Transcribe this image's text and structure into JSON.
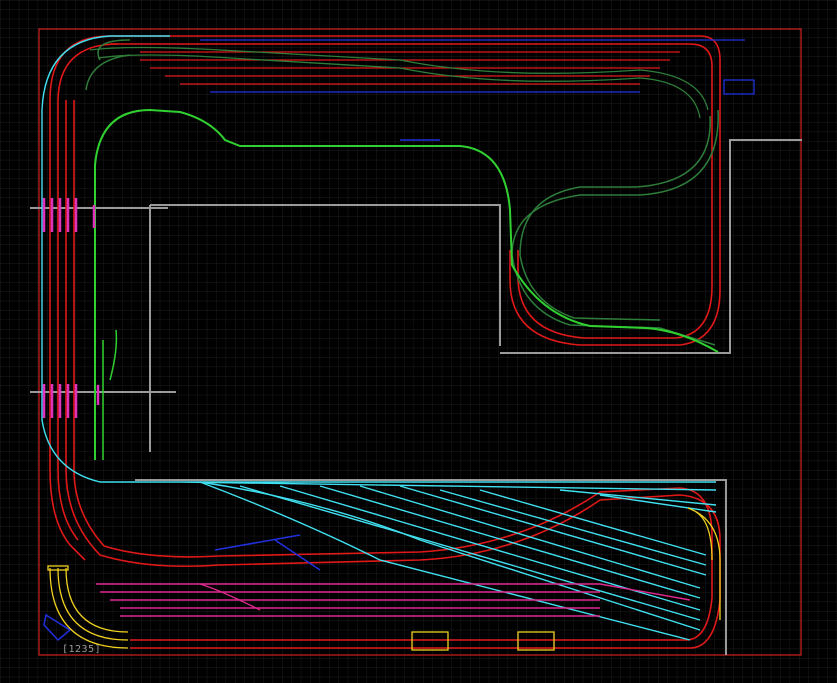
{
  "app": {
    "view": "track-layout-plan"
  },
  "colors": {
    "background": "#000000",
    "grid": "#2a2a2a",
    "border": "#d02020",
    "wall": "#9a9a9a",
    "main_red": "#e01818",
    "dark_green": "#2e7d3a",
    "bright_green": "#30d030",
    "cyan": "#40e0f0",
    "magenta": "#e030c0",
    "pink": "#e02890",
    "blue": "#2030e0",
    "yellow": "#f0d020"
  },
  "status": {
    "track_count_label": "[1235]"
  }
}
